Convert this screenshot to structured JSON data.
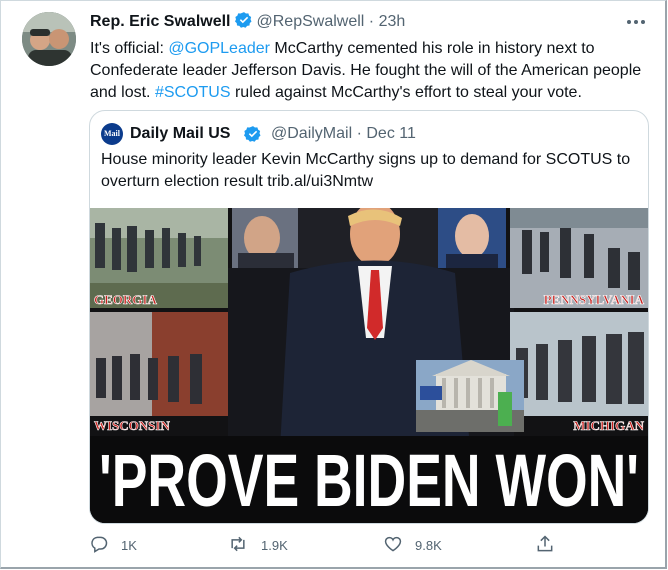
{
  "tweet": {
    "author_name": "Rep. Eric Swalwell",
    "handle": "@RepSwalwell",
    "separator": "·",
    "time": "23h",
    "text_parts": [
      {
        "t": "It's official: ",
        "link": false
      },
      {
        "t": "@GOPLeader",
        "link": true
      },
      {
        "t": " McCarthy cemented his role in history next to Confederate leader Jefferson Davis. He fought the will of the American people and lost. ",
        "link": false
      },
      {
        "t": "#SCOTUS",
        "link": true
      },
      {
        "t": " ruled against McCarthy's effort to steal your vote.",
        "link": false
      }
    ]
  },
  "quoted": {
    "logo_text": "Mail",
    "name": "Daily Mail US",
    "handle_time": "@DailyMail · Dec 11",
    "text": "House minority leader Kevin McCarthy signs up to demand for SCOTUS to overturn election result trib.al/ui3Nmtw",
    "image": {
      "labels": {
        "georgia": "GEORGIA",
        "pennsylvania": "PENNSYLVANIA",
        "wisconsin": "WISCONSIN",
        "michigan": "MICHIGAN"
      },
      "headline": "'PROVE BIDEN WON'"
    }
  },
  "actions": {
    "reply_count": "1K",
    "retweet_count": "1.9K",
    "like_count": "9.8K"
  },
  "colors": {
    "link": "#1d9bf0",
    "verified": "#1d9bf0",
    "secondary_text": "#536471",
    "state_label_red": "#c8201d"
  }
}
